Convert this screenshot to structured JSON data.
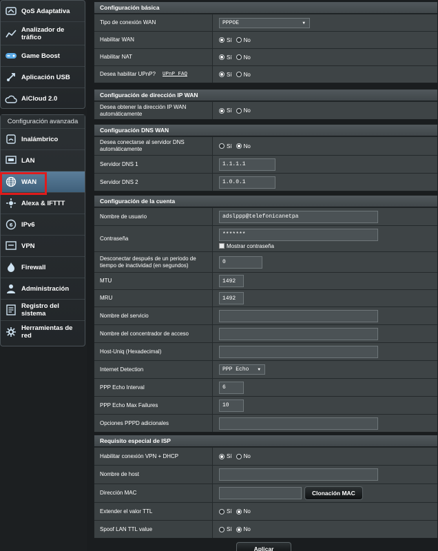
{
  "sidebar": {
    "general_items": [
      {
        "label": "QoS Adaptativa",
        "icon": "qos-icon"
      },
      {
        "label": "Analizador de tráfico",
        "icon": "traffic-analyzer-icon"
      },
      {
        "label": "Game Boost",
        "icon": "gamepad-icon"
      },
      {
        "label": "Aplicación USB",
        "icon": "usb-icon"
      },
      {
        "label": "AiCloud 2.0",
        "icon": "cloud-icon"
      }
    ],
    "advanced_header": "Configuración avanzada",
    "advanced_items": [
      {
        "label": "Inalámbrico",
        "icon": "wireless-icon"
      },
      {
        "label": "LAN",
        "icon": "lan-icon"
      },
      {
        "label": "WAN",
        "icon": "globe-icon"
      },
      {
        "label": "Alexa & IFTTT",
        "icon": "alexa-icon"
      },
      {
        "label": "IPv6",
        "icon": "ipv6-icon"
      },
      {
        "label": "VPN",
        "icon": "vpn-icon"
      },
      {
        "label": "Firewall",
        "icon": "firewall-icon"
      },
      {
        "label": "Administración",
        "icon": "admin-icon"
      },
      {
        "label": "Registro del sistema",
        "icon": "system-log-icon"
      },
      {
        "label": "Herramientas de red",
        "icon": "network-tools-icon"
      }
    ],
    "active_item": "WAN"
  },
  "basic": {
    "title": "Configuración básica",
    "wan_type_label": "Tipo de conexión WAN",
    "wan_type_value": "PPPOE",
    "enable_wan_label": "Habilitar WAN",
    "enable_nat_label": "Habilitar NAT",
    "upnp_label": "Desea habilitar UPnP?",
    "upnp_link": "UPnP FAQ"
  },
  "radio_labels": {
    "yes": "Sí",
    "no": "No"
  },
  "wan_ip": {
    "title": "Configuración de dirección IP WAN",
    "auto_ip_label": "Desea obtener la dirección IP WAN automáticamente"
  },
  "dns": {
    "title": "Configuración DNS WAN",
    "auto_dns_label": "Desea conectarse al servidor DNS automáticamente",
    "dns1_label": "Servidor DNS 1",
    "dns1_value": "1.1.1.1",
    "dns2_label": "Servidor DNS 2",
    "dns2_value": "1.0.0.1"
  },
  "account": {
    "title": "Configuración de la cuenta",
    "username_label": "Nombre de usuario",
    "username_value": "adslppp@telefonicanetpa",
    "password_label": "Contraseña",
    "password_value": "*******",
    "show_password_label": "Mostrar contraseña",
    "idle_label": "Desconectar después de un periodo de tiempo de inactividad (en segundos)",
    "idle_value": "0",
    "mtu_label": "MTU",
    "mtu_value": "1492",
    "mru_label": "MRU",
    "mru_value": "1492",
    "service_label": "Nombre del servicio",
    "concentrator_label": "Nombre del concentrador de acceso",
    "hostuniq_label": "Host-Uniq (Hexadecimal)",
    "internet_detection_label": "Internet Detection",
    "internet_detection_value": "PPP Echo",
    "echo_interval_label": "PPP Echo Interval",
    "echo_interval_value": "6",
    "echo_failures_label": "PPP Echo Max Failures",
    "echo_failures_value": "10",
    "pppd_label": "Opciones PPPD adicionales"
  },
  "isp": {
    "title": "Requisito especial de ISP",
    "vpn_dhcp_label": "Habilitar conexión VPN + DHCP",
    "hostname_label": "Nombre de host",
    "mac_label": "Dirección MAC",
    "mac_clone_label": "Clonación MAC",
    "ttl_label": "Extender el valor TTL",
    "spoof_ttl_label": "Spoof LAN TTL value"
  },
  "apply_label": "Aplicar",
  "colors": {
    "highlight": "#e01b1b",
    "active_item": "#4f7190"
  }
}
